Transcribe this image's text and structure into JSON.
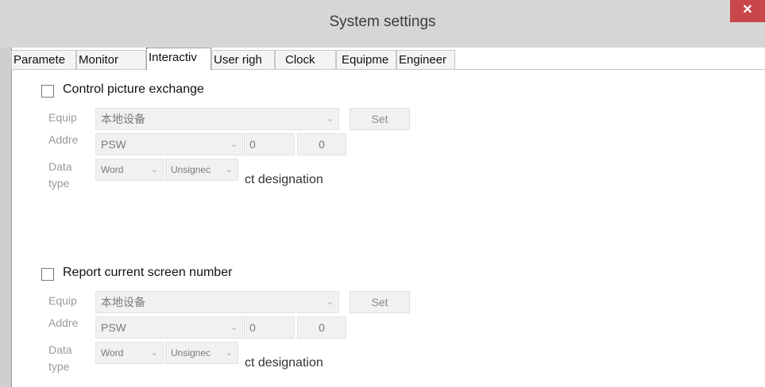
{
  "window": {
    "title": "System settings",
    "close_glyph": "✕"
  },
  "tabs": [
    {
      "label": "Paramete",
      "active": false
    },
    {
      "label": "Monitor",
      "active": false
    },
    {
      "label": "Interactiv",
      "active": true
    },
    {
      "label": "User righ",
      "active": false
    },
    {
      "label": "Clock",
      "active": false
    },
    {
      "label": "Equipme",
      "active": false
    },
    {
      "label": "Engineer",
      "active": false
    }
  ],
  "sections": [
    {
      "checkbox_label": "Control picture exchange",
      "checked": false,
      "equip_label": "Equip",
      "equip_value": "本地设备",
      "set_label": "Set",
      "addr_label": "Addre",
      "addr_value": "PSW",
      "addr_num1": "0",
      "addr_num2": "0",
      "data_label": "Data",
      "type_label": "type",
      "data_width": "Word",
      "data_sign": "Unsignec",
      "note": "ct designation"
    },
    {
      "checkbox_label": "Report current screen number",
      "checked": false,
      "equip_label": "Equip",
      "equip_value": "本地设备",
      "set_label": "Set",
      "addr_label": "Addre",
      "addr_value": "PSW",
      "addr_num1": "0",
      "addr_num2": "0",
      "data_label": "Data",
      "type_label": "type",
      "data_width": "Word",
      "data_sign": "Unsignec",
      "note": "ct designation"
    }
  ],
  "icons": {
    "chevron": "chevron-down-icon",
    "close": "close-icon"
  }
}
